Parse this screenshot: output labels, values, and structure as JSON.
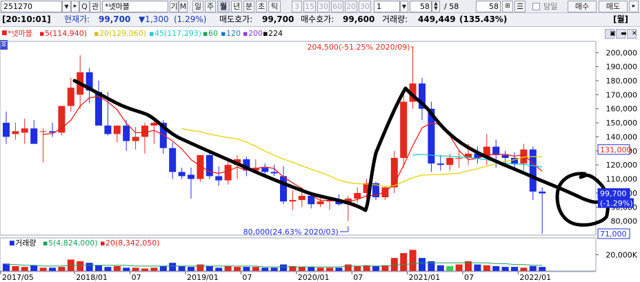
{
  "toolbar": {
    "code": "251270",
    "search_label": "Q",
    "kwan_label": "관",
    "stock_name": "*넷마블",
    "gi_label": "기",
    "m_label": "M",
    "periods": [
      "일",
      "주",
      "월",
      "년",
      "분",
      "초",
      "틱"
    ],
    "selected_period": "월",
    "intervals": [
      "3",
      "15",
      "30",
      "60",
      "20",
      "30",
      "1"
    ],
    "count_value": "58",
    "count_total": "/ 58",
    "count_right": "58",
    "danil_label": "당일",
    "buy_label": "매수",
    "sell_label": "매도"
  },
  "quote": {
    "time": "[20:10:01]",
    "price_label": "현재가:",
    "price": "99,700",
    "change": "▼1,300",
    "change_pct": "(1.29%)",
    "ask_label": "매도호가:",
    "ask": "99,700",
    "bid_label": "매수호가:",
    "bid": "99,600",
    "volume_label": "거래량:",
    "volume": "449,449",
    "volume_pct": "(135.43%)",
    "period": "[월]"
  },
  "legend": {
    "ho": "호",
    "name": "*넷마블",
    "ma5": "5(114,940)",
    "ma20": "20(129,060)",
    "ma45": "45(117,293)",
    "ma60": "60",
    "ma120": "120",
    "ma200": "200",
    "ma224": "224"
  },
  "volume_legend": {
    "name": "거래량",
    "ma5": "5(4,824,000)",
    "ma20": "20(8,342,050)"
  },
  "annotations": {
    "high": "204,500(-51.25% 2020/09)",
    "low": "80,000(24.63% 2020/03)"
  },
  "price_tags": {
    "prev": "131,000",
    "current": "99,700",
    "current_pct": "(-1.29%)",
    "low": "71,000"
  },
  "colors": {
    "up": "#e3281e",
    "down": "#1e2ee0",
    "ma5": "#e51c1c",
    "ma20": "#e6d200",
    "ma45": "#1fc9c9",
    "ma60": "#16a05a",
    "ma120": "#1976d2",
    "ma200": "#8e3ad6",
    "ma224": "#000000"
  },
  "chart_data": {
    "type": "candlestick",
    "yaxis_labels": [
      "200,000",
      "190,000",
      "180,000",
      "170,000",
      "160,000",
      "150,000",
      "140,000",
      "130,000",
      "120,000",
      "110,000",
      "100,000",
      "90,000",
      "80,000"
    ],
    "ylim": [
      70000,
      208000
    ],
    "volume_axis_label": "20,000K",
    "x_labels": [
      "2017/05",
      "2018/01",
      "07",
      "2019/01",
      "07",
      "2020/01",
      "07",
      "2021/01",
      "07",
      "2022/01"
    ],
    "x_label_index": [
      0,
      8,
      14,
      20,
      26,
      32,
      38,
      44,
      50,
      56
    ],
    "candles": [
      {
        "o": 150000,
        "h": 158000,
        "l": 135000,
        "c": 140000
      },
      {
        "o": 142000,
        "h": 150000,
        "l": 138000,
        "c": 144000
      },
      {
        "o": 143000,
        "h": 153000,
        "l": 135000,
        "c": 146000
      },
      {
        "o": 146000,
        "h": 152000,
        "l": 140000,
        "c": 135000
      },
      {
        "o": 144000,
        "h": 146000,
        "l": 122000,
        "c": 144000
      },
      {
        "o": 144000,
        "h": 150000,
        "l": 140000,
        "c": 143000
      },
      {
        "o": 143000,
        "h": 160000,
        "l": 141000,
        "c": 162000
      },
      {
        "o": 162000,
        "h": 182000,
        "l": 158000,
        "c": 175000
      },
      {
        "o": 170000,
        "h": 198000,
        "l": 160000,
        "c": 186000
      },
      {
        "o": 186000,
        "h": 189000,
        "l": 164000,
        "c": 173000
      },
      {
        "o": 172000,
        "h": 180000,
        "l": 150000,
        "c": 148000
      },
      {
        "o": 148000,
        "h": 172000,
        "l": 141000,
        "c": 142000
      },
      {
        "o": 142000,
        "h": 148000,
        "l": 136000,
        "c": 148000
      },
      {
        "o": 148000,
        "h": 152000,
        "l": 130000,
        "c": 137000
      },
      {
        "o": 137000,
        "h": 147000,
        "l": 131000,
        "c": 140000
      },
      {
        "o": 140000,
        "h": 150000,
        "l": 128000,
        "c": 148000
      },
      {
        "o": 148000,
        "h": 153000,
        "l": 135000,
        "c": 150000
      },
      {
        "o": 150000,
        "h": 152000,
        "l": 128000,
        "c": 132000
      },
      {
        "o": 132000,
        "h": 136000,
        "l": 110000,
        "c": 115000
      },
      {
        "o": 115000,
        "h": 118000,
        "l": 110000,
        "c": 112000
      },
      {
        "o": 113000,
        "h": 118000,
        "l": 96000,
        "c": 110000
      },
      {
        "o": 110000,
        "h": 127000,
        "l": 108000,
        "c": 127000
      },
      {
        "o": 127000,
        "h": 130000,
        "l": 110000,
        "c": 112000
      },
      {
        "o": 112000,
        "h": 119000,
        "l": 105000,
        "c": 109000
      },
      {
        "o": 109000,
        "h": 125000,
        "l": 106000,
        "c": 120000
      },
      {
        "o": 120000,
        "h": 127000,
        "l": 110000,
        "c": 124000
      },
      {
        "o": 124000,
        "h": 126000,
        "l": 112000,
        "c": 116000
      },
      {
        "o": 116000,
        "h": 124000,
        "l": 114000,
        "c": 118000
      },
      {
        "o": 118000,
        "h": 121000,
        "l": 112000,
        "c": 115000
      },
      {
        "o": 115000,
        "h": 120000,
        "l": 112000,
        "c": 114000
      },
      {
        "o": 112000,
        "h": 119000,
        "l": 92000,
        "c": 94000
      },
      {
        "o": 94000,
        "h": 102000,
        "l": 88000,
        "c": 95000
      },
      {
        "o": 95000,
        "h": 104000,
        "l": 90000,
        "c": 98000
      },
      {
        "o": 98000,
        "h": 100000,
        "l": 89000,
        "c": 92000
      },
      {
        "o": 92000,
        "h": 97000,
        "l": 90000,
        "c": 94000
      },
      {
        "o": 94000,
        "h": 97000,
        "l": 88000,
        "c": 95000
      },
      {
        "o": 95000,
        "h": 99000,
        "l": 91000,
        "c": 92000
      },
      {
        "o": 92000,
        "h": 98000,
        "l": 80000,
        "c": 96000
      },
      {
        "o": 96000,
        "h": 104000,
        "l": 93000,
        "c": 100000
      },
      {
        "o": 100000,
        "h": 110000,
        "l": 96000,
        "c": 107000
      },
      {
        "o": 107000,
        "h": 108000,
        "l": 95000,
        "c": 97000
      },
      {
        "o": 97000,
        "h": 105000,
        "l": 95000,
        "c": 104000
      },
      {
        "o": 104000,
        "h": 130000,
        "l": 100000,
        "c": 125000
      },
      {
        "o": 125000,
        "h": 170000,
        "l": 118000,
        "c": 165000
      },
      {
        "o": 165000,
        "h": 204500,
        "l": 160000,
        "c": 178000
      },
      {
        "o": 178000,
        "h": 182000,
        "l": 152000,
        "c": 160000
      },
      {
        "o": 160000,
        "h": 165000,
        "l": 115000,
        "c": 121000
      },
      {
        "o": 121000,
        "h": 127000,
        "l": 116000,
        "c": 120000
      },
      {
        "o": 120000,
        "h": 128000,
        "l": 116000,
        "c": 125000
      },
      {
        "o": 125000,
        "h": 130000,
        "l": 118000,
        "c": 125000
      },
      {
        "o": 125000,
        "h": 135000,
        "l": 120000,
        "c": 128000
      },
      {
        "o": 128000,
        "h": 133000,
        "l": 121000,
        "c": 125000
      },
      {
        "o": 125000,
        "h": 142000,
        "l": 120000,
        "c": 133000
      },
      {
        "o": 133000,
        "h": 138000,
        "l": 118000,
        "c": 127000
      },
      {
        "o": 127000,
        "h": 130000,
        "l": 120000,
        "c": 125000
      },
      {
        "o": 125000,
        "h": 129000,
        "l": 116000,
        "c": 121000
      },
      {
        "o": 121000,
        "h": 135000,
        "l": 116000,
        "c": 131000
      },
      {
        "o": 131000,
        "h": 133000,
        "l": 95000,
        "c": 101000
      },
      {
        "o": 101000,
        "h": 104000,
        "l": 71000,
        "c": 99700
      }
    ],
    "volume": [
      9,
      6,
      5,
      7,
      4,
      4,
      5,
      14,
      12,
      10,
      7,
      5,
      6,
      4,
      4,
      3,
      4,
      6,
      10,
      6,
      5,
      8,
      6,
      4,
      6,
      5,
      5,
      5,
      4,
      4,
      8,
      6,
      5,
      5,
      4,
      4,
      4,
      8,
      6,
      7,
      6,
      7,
      16,
      22,
      26,
      16,
      12,
      7,
      6,
      8,
      12,
      8,
      7,
      6,
      5,
      5,
      4,
      6,
      5
    ],
    "volume_ma20": [
      8,
      8,
      7,
      7,
      6,
      6,
      6,
      7,
      7,
      7,
      7,
      7,
      7,
      7,
      6,
      6,
      6,
      6,
      6,
      6,
      6,
      6,
      6,
      6,
      6,
      6,
      6,
      6,
      5,
      5,
      5,
      5,
      5,
      5,
      5,
      5,
      5,
      6,
      6,
      6,
      6,
      6,
      7,
      8,
      9,
      10,
      10,
      10,
      10,
      10,
      10,
      10,
      10,
      9,
      9,
      8,
      8,
      7,
      7
    ]
  }
}
